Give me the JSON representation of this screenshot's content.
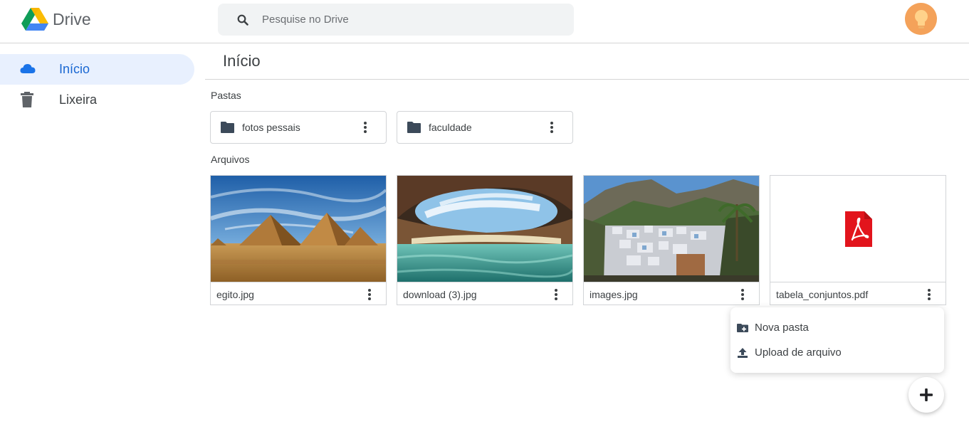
{
  "app": {
    "name": "Drive"
  },
  "search": {
    "placeholder": "Pesquise no Drive",
    "value": ""
  },
  "sidebar": {
    "items": [
      {
        "label": "Início",
        "icon": "cloud-icon",
        "active": true
      },
      {
        "label": "Lixeira",
        "icon": "trash-icon",
        "active": false
      }
    ]
  },
  "main": {
    "title": "Início",
    "folders_label": "Pastas",
    "folders": [
      {
        "name": "fotos pessais"
      },
      {
        "name": "faculdade"
      }
    ],
    "files_label": "Arquivos",
    "files": [
      {
        "name": "egito.jpg",
        "thumbnail": "pyramids-image"
      },
      {
        "name": "download (3).jpg",
        "thumbnail": "cave-beach-image"
      },
      {
        "name": "images.jpg",
        "thumbnail": "mountain-town-image"
      },
      {
        "name": "tabela_conjuntos.pdf",
        "thumbnail": "pdf-icon"
      }
    ]
  },
  "new_menu": {
    "items": [
      {
        "label": "Nova pasta",
        "icon": "new-folder-icon"
      },
      {
        "label": "Upload de arquivo",
        "icon": "upload-icon"
      }
    ]
  },
  "fab": {
    "icon": "plus-icon"
  },
  "colors": {
    "accent": "#1967d2",
    "active_nav_bg": "#e8f0fe",
    "avatar": "#f4a25a",
    "pdf_red": "#e2141c"
  }
}
